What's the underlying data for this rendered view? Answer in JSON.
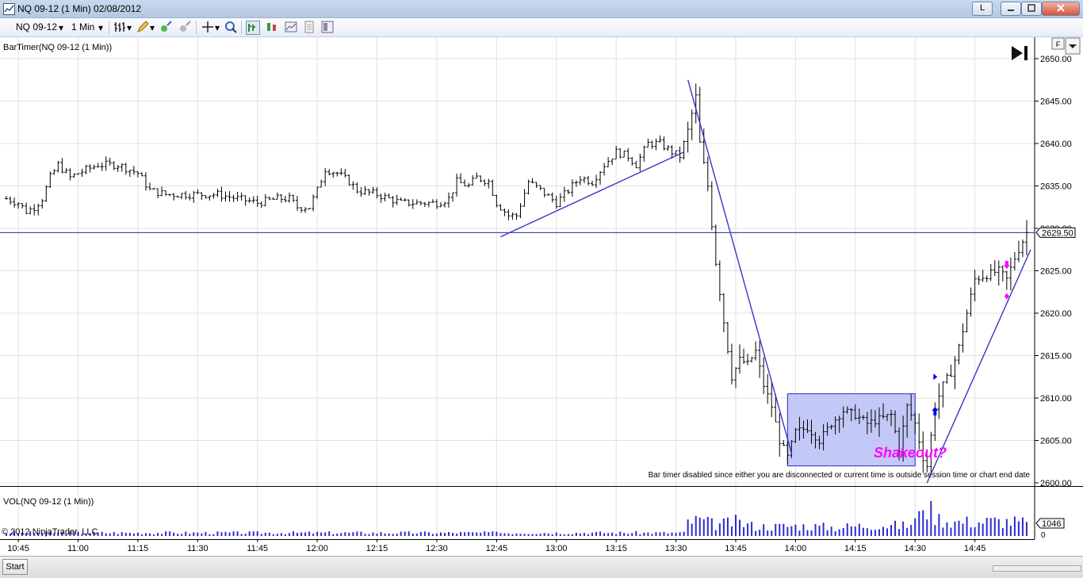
{
  "window": {
    "title": "NQ 09-12 (1 Min)  02/08/2012",
    "btn_l": "L"
  },
  "toolbar": {
    "instrument": "NQ 09-12",
    "interval": "1 Min"
  },
  "indicator_label": "BarTimer(NQ 09-12 (1 Min))",
  "volume_label": "VOL(NQ 09-12 (1 Min))",
  "copyright": "© 2012 NinjaTrader, LLC",
  "status": {
    "start_label": "Start",
    "f_label": "F"
  },
  "annotations": {
    "shakeout": "Shakeout?",
    "bar_timer_msg": "Bar timer disabled since either you are disconnected or current time is outside session time or chart end date"
  },
  "colors": {
    "trendline": "#3535c8",
    "marker_pink": "#ff00ff",
    "marker_blue": "#0000ff",
    "range_box": "#b9bff6",
    "volume_bars": "#2b2bd1",
    "grid": "#e2e2e2",
    "price_bars": "#000000"
  },
  "chart_data": [
    {
      "type": "ohlc",
      "title": "NQ 09-12 (1 Min)",
      "x": [
        "10:45",
        "11:00",
        "11:15",
        "11:30",
        "11:45",
        "12:00",
        "12:15",
        "12:30",
        "12:45",
        "13:00",
        "13:15",
        "13:30",
        "13:45",
        "14:00",
        "14:15",
        "14:30",
        "14:45"
      ],
      "xlim": [
        "10:42",
        "14:59"
      ],
      "ylim": [
        2595,
        2652
      ],
      "yticks": [
        2600.0,
        2605.0,
        2610.0,
        2615.0,
        2620.0,
        2625.0,
        2630.0,
        2635.0,
        2640.0,
        2645.0,
        2650.0
      ],
      "ytick_labels": [
        "2600.00",
        "2605.00",
        "2610.00",
        "2615.00",
        "2620.00",
        "2625.00",
        "2630.00",
        "2635.00",
        "2640.00",
        "2645.00",
        "2650.00"
      ],
      "current_price_label": "2629.50",
      "current_price": 2629.5,
      "price_path_anchors": [
        [
          "10:42",
          2633.5
        ],
        [
          "10:45",
          2633.0
        ],
        [
          "10:47",
          2632.0
        ],
        [
          "10:49",
          2632.5
        ],
        [
          "10:51",
          2633.5
        ],
        [
          "10:53",
          2636.0
        ],
        [
          "10:55",
          2637.5
        ],
        [
          "10:58",
          2636.0
        ],
        [
          "11:00",
          2636.5
        ],
        [
          "11:05",
          2637.5
        ],
        [
          "11:10",
          2637.5
        ],
        [
          "11:15",
          2636.5
        ],
        [
          "11:18",
          2634.5
        ],
        [
          "11:22",
          2634.0
        ],
        [
          "11:25",
          2634.0
        ],
        [
          "11:30",
          2634.0
        ],
        [
          "11:35",
          2634.0
        ],
        [
          "11:40",
          2633.5
        ],
        [
          "11:45",
          2633.0
        ],
        [
          "11:50",
          2633.5
        ],
        [
          "11:53",
          2633.5
        ],
        [
          "11:55",
          2632.5
        ],
        [
          "11:58",
          2632.5
        ],
        [
          "12:00",
          2634.5
        ],
        [
          "12:02",
          2637.0
        ],
        [
          "12:05",
          2636.5
        ],
        [
          "12:08",
          2635.5
        ],
        [
          "12:10",
          2634.5
        ],
        [
          "12:15",
          2634.0
        ],
        [
          "12:18",
          2633.5
        ],
        [
          "12:21",
          2633.0
        ],
        [
          "12:25",
          2633.0
        ],
        [
          "12:30",
          2633.0
        ],
        [
          "12:33",
          2633.5
        ],
        [
          "12:35",
          2635.5
        ],
        [
          "12:38",
          2635.0
        ],
        [
          "12:40",
          2636.0
        ],
        [
          "12:43",
          2635.5
        ],
        [
          "12:45",
          2633.0
        ],
        [
          "12:48",
          2631.5
        ],
        [
          "12:50",
          2631.5
        ],
        [
          "12:53",
          2635.5
        ],
        [
          "12:56",
          2634.5
        ],
        [
          "13:00",
          2633.0
        ],
        [
          "13:03",
          2634.5
        ],
        [
          "13:06",
          2636.0
        ],
        [
          "13:09",
          2635.5
        ],
        [
          "13:12",
          2637.5
        ],
        [
          "13:15",
          2639.0
        ],
        [
          "13:18",
          2638.5
        ],
        [
          "13:20",
          2637.5
        ],
        [
          "13:23",
          2640.0
        ],
        [
          "13:26",
          2640.0
        ],
        [
          "13:29",
          2639.0
        ],
        [
          "13:31",
          2638.5
        ],
        [
          "13:33",
          2641.5
        ],
        [
          "13:35",
          2645.5
        ],
        [
          "13:36",
          2640.0
        ],
        [
          "13:38",
          2635.0
        ],
        [
          "13:40",
          2626.0
        ],
        [
          "13:42",
          2619.0
        ],
        [
          "13:44",
          2612.5
        ],
        [
          "13:46",
          2614.5
        ],
        [
          "13:48",
          2614.0
        ],
        [
          "13:50",
          2615.5
        ],
        [
          "13:52",
          2611.5
        ],
        [
          "13:54",
          2609.0
        ],
        [
          "13:56",
          2605.0
        ],
        [
          "13:58",
          2603.0
        ],
        [
          "14:00",
          2606.0
        ],
        [
          "14:03",
          2606.5
        ],
        [
          "14:06",
          2605.0
        ],
        [
          "14:09",
          2607.0
        ],
        [
          "14:12",
          2608.5
        ],
        [
          "14:15",
          2608.0
        ],
        [
          "14:18",
          2607.0
        ],
        [
          "14:21",
          2607.5
        ],
        [
          "14:24",
          2608.0
        ],
        [
          "14:26",
          2604.0
        ],
        [
          "14:28",
          2609.0
        ],
        [
          "14:30",
          2607.0
        ],
        [
          "14:32",
          2603.0
        ],
        [
          "14:33",
          2602.0
        ],
        [
          "14:35",
          2609.0
        ],
        [
          "14:37",
          2611.5
        ],
        [
          "14:39",
          2613.0
        ],
        [
          "14:41",
          2616.0
        ],
        [
          "14:43",
          2620.0
        ],
        [
          "14:45",
          2624.0
        ],
        [
          "14:48",
          2624.5
        ],
        [
          "14:51",
          2625.0
        ],
        [
          "14:53",
          2624.0
        ],
        [
          "14:55",
          2626.5
        ],
        [
          "14:57",
          2628.5
        ],
        [
          "14:58",
          2629.5
        ]
      ],
      "horizontal_line": 2629.5,
      "trendlines": [
        {
          "from": [
            "12:46",
            2629.0
          ],
          "to": [
            "13:32",
            2639.0
          ]
        },
        {
          "from": [
            "13:33",
            2647.5
          ],
          "to": [
            "13:59",
            2603.5
          ]
        },
        {
          "from": [
            "14:33",
            2600.0
          ],
          "to": [
            "14:59",
            2627.5
          ]
        }
      ],
      "range_box": {
        "x": [
          "13:58",
          "14:30"
        ],
        "y": [
          2602.0,
          2610.5
        ]
      },
      "markers": [
        {
          "type": "arrow-down",
          "color": "pink",
          "at": [
            "14:53",
            2625.5
          ]
        },
        {
          "type": "arrow-up",
          "color": "blue",
          "at": [
            "14:35",
            2608.5
          ]
        },
        {
          "type": "triangle-right",
          "color": "blue",
          "at": [
            "14:35",
            2612.5
          ]
        },
        {
          "type": "diamond",
          "color": "pink",
          "at": [
            "14:53",
            2622.0
          ]
        }
      ]
    },
    {
      "type": "bar",
      "title": "VOL(NQ 09-12 (1 Min))",
      "current_value_label": "1046",
      "ylim": [
        0,
        3000
      ],
      "yticks": [
        0
      ],
      "volume_profile": [
        [
          "10:42",
          200
        ],
        [
          "12:44",
          200
        ],
        [
          "12:45",
          500
        ],
        [
          "12:46",
          200
        ],
        [
          "13:32",
          200
        ],
        [
          "13:33",
          900
        ],
        [
          "13:36",
          1000
        ],
        [
          "13:40",
          700
        ],
        [
          "13:45",
          900
        ],
        [
          "13:50",
          600
        ],
        [
          "13:55",
          600
        ],
        [
          "14:00",
          650
        ],
        [
          "14:10",
          550
        ],
        [
          "14:20",
          700
        ],
        [
          "14:28",
          650
        ],
        [
          "14:31",
          1200
        ],
        [
          "14:32",
          2500
        ],
        [
          "14:33",
          1800
        ],
        [
          "14:36",
          1100
        ],
        [
          "14:40",
          900
        ],
        [
          "14:45",
          900
        ],
        [
          "14:50",
          950
        ],
        [
          "14:55",
          900
        ],
        [
          "14:58",
          800
        ]
      ]
    }
  ]
}
